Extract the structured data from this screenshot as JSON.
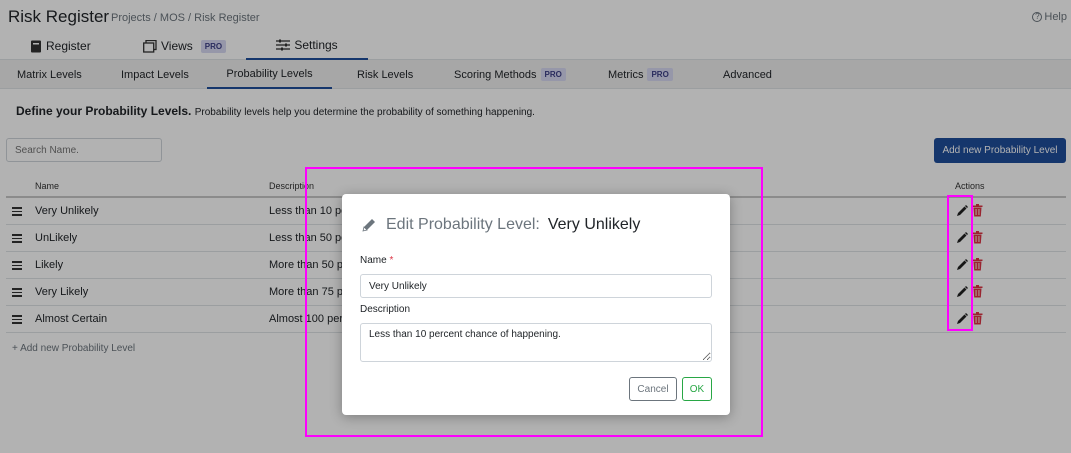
{
  "header": {
    "title": "Risk Register",
    "breadcrumb": "Projects / MOS / Risk Register",
    "help": "Help"
  },
  "main_tabs": [
    {
      "label": "Register",
      "icon": "book-icon",
      "pro": ""
    },
    {
      "label": "Views",
      "icon": "windows-icon",
      "pro": "PRO"
    },
    {
      "label": "Settings",
      "icon": "sliders-icon",
      "pro": "",
      "active": true
    }
  ],
  "sub_tabs": [
    {
      "label": "Matrix Levels",
      "pro": ""
    },
    {
      "label": "Impact Levels",
      "pro": ""
    },
    {
      "label": "Probability Levels",
      "pro": "",
      "active": true
    },
    {
      "label": "Risk Levels",
      "pro": ""
    },
    {
      "label": "Scoring Methods",
      "pro": "PRO"
    },
    {
      "label": "Metrics",
      "pro": "PRO"
    },
    {
      "label": "Advanced",
      "pro": ""
    }
  ],
  "define": {
    "heading": "Define your Probability Levels.",
    "text": "Probability levels help you determine the probability of something happening."
  },
  "search": {
    "placeholder": "Search Name."
  },
  "add_button": "Add new Probability Level",
  "table": {
    "headers": {
      "name": "Name",
      "description": "Description",
      "actions": "Actions"
    },
    "rows": [
      {
        "name": "Very Unlikely",
        "description": "Less than 10 pe"
      },
      {
        "name": "UnLikely",
        "description": "Less than 50 pe"
      },
      {
        "name": "Likely",
        "description": "More than 50 p"
      },
      {
        "name": "Very Likely",
        "description": "More than 75 p"
      },
      {
        "name": "Almost Certain",
        "description": "Almost 100 per"
      }
    ]
  },
  "add_link": "Add new Probability Level",
  "modal": {
    "title_prefix": "Edit Probability Level:",
    "title_value": "Very Unlikely",
    "name_label": "Name",
    "required_mark": "*",
    "name_value": "Very Unlikely",
    "description_label": "Description",
    "description_value": "Less than 10 percent chance of happening.",
    "cancel": "Cancel",
    "ok": "OK"
  },
  "colors": {
    "primary": "#1f4e9b",
    "delete": "#dc3545",
    "highlight": "#ff00ff",
    "ok_border": "#28a745"
  }
}
